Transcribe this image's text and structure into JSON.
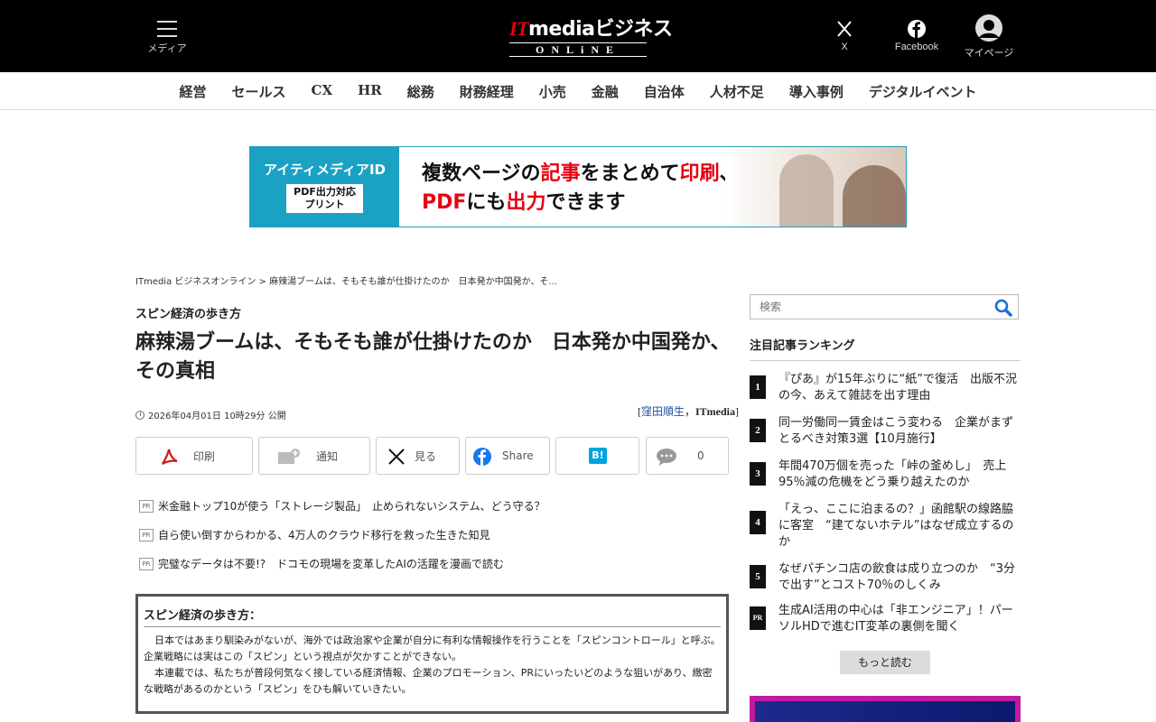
{
  "header": {
    "menu_label": "メディア",
    "logo_prefix": "IT",
    "logo_main": "mediaビジネス",
    "logo_sub": "ONLiNE",
    "x_label": "X",
    "facebook_label": "Facebook",
    "mypage_label": "マイページ"
  },
  "categories": [
    "経営",
    "セールス",
    "CX",
    "HR",
    "総務",
    "財務経理",
    "小売",
    "金融",
    "自治体",
    "人材不足",
    "導入事例",
    "デジタルイベント"
  ],
  "banner": {
    "brand": "アイティメディアID",
    "badge_line1": "PDF出力対応",
    "badge_line2": "プリント",
    "copy_line1_a": "複数ページの",
    "copy_line1_b": "記事",
    "copy_line1_c": "をまとめて",
    "copy_line1_d": "印刷",
    "copy_line1_e": "、",
    "copy_line2_a": "PDF",
    "copy_line2_b": "にも",
    "copy_line2_c": "出力",
    "copy_line2_d": "できます"
  },
  "article": {
    "breadcrumb": "ITmedia ビジネスオンライン > 麻辣湯ブームは、そもそも誰が仕掛けたのか　日本発か中国発か、そ...",
    "series": "スピン経済の歩き方",
    "title": "麻辣湯ブームは、そもそも誰が仕掛けたのか　日本発か中国発か、その真相",
    "date": "2026年04月01日 10時29分 公開",
    "author_open": "[",
    "author_name": "窪田順生",
    "author_sep": "，",
    "author_org": "ITmedia",
    "author_close": "]"
  },
  "share": {
    "print": "印刷",
    "notify": "通知",
    "x": "見る",
    "facebook": "Share",
    "hatena": "B!",
    "comment_count": "0"
  },
  "pr_items": [
    {
      "tag": "PR",
      "text": "米金融トップ10が使う「ストレージ製品」　止められないシステム、どう守る？"
    },
    {
      "tag": "PR",
      "text": "自ら使い倒すからわかる、4万人のクラウド移行を救った生きた知見"
    },
    {
      "tag": "PR",
      "text": "完璧なデータは不要!?　ドコモの現場を変革したAIの活躍を漫画で読む"
    }
  ],
  "series_box": {
    "heading": "スピン経済の歩き方：",
    "p1": "日本ではあまり馴染みがないが、海外では政治家や企業が自分に有利な情報操作を行うことを「スピンコントロール」と呼ぶ。企業戦略には実はこの「スピン」という視点が欠かすことができない。",
    "p2": "本連載では、私たちが普段何気なく接している経済情報、企業のプロモーション、PRにいったいどのような狙いがあり、緻密な戦略があるのかという「スピン」をひも解いていきたい。"
  },
  "sidebar": {
    "search_placeholder": "検索",
    "ranking_heading": "注目記事ランキング",
    "ranking": [
      {
        "num": "1",
        "text": "『ぴあ』が15年ぶりに“紙”で復活　出版不況の今、あえて雑誌を出す理由"
      },
      {
        "num": "2",
        "text": "同一労働同一賃金はこう変わる　企業がまずとるべき対策3選【10月施行】"
      },
      {
        "num": "3",
        "text": "年間470万個を売った「峠の釜めし」　売上95％減の危機をどう乗り越えたのか"
      },
      {
        "num": "4",
        "text": "「えっ、ここに泊まるの？」函館駅の線路脇に客室　“建てないホテル”はなぜ成立するのか"
      },
      {
        "num": "5",
        "text": "なぜパチンコ店の飲食は成り立つのか　“3分で出す”とコスト70％のしくみ"
      },
      {
        "num": "PR",
        "text": "生成AI活用の中心は「非エンジニア」！パーソルHDで進むIT変革の裏側を聞く"
      }
    ],
    "more_label": "もっと読む"
  },
  "colors": {
    "header_bg": "#000000",
    "brand_red": "#e60012",
    "banner_blue": "#1aa1c4",
    "link_blue": "#1a4fa0"
  }
}
